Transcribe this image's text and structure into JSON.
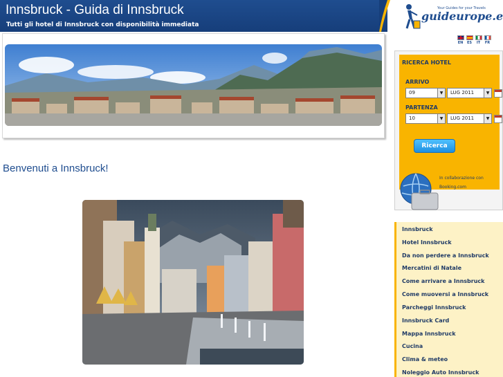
{
  "header": {
    "title": "Innsbruck - Guida di Innsbruck",
    "subtitle": "Tutti gli hotel di Innsbruck con disponibilità immediata"
  },
  "logo": {
    "brand": "guideurope.eu",
    "tagline": "Your Guides for your Travels"
  },
  "languages": [
    {
      "code": "EN"
    },
    {
      "code": "ES"
    },
    {
      "code": "IT"
    },
    {
      "code": "FR"
    }
  ],
  "main": {
    "welcome": "Benvenuti a Innsbruck!"
  },
  "search": {
    "title": "RICERCA HOTEL",
    "arrival_label": "ARRIVO",
    "arrival_day": "09",
    "arrival_month": "LUG 2011",
    "departure_label": "PARTENZA",
    "departure_day": "10",
    "departure_month": "LUG 2011",
    "button_label": "Ricerca",
    "collab_text": "In collaborazione con Booking.com"
  },
  "nav": {
    "items": [
      "Innsbruck",
      "Hotel Innsbruck",
      "Da non perdere a Innsbruck",
      "Mercatini di Natale",
      "Come arrivare a Innsbruck",
      "Come muoversi a Innsbruck",
      "Parcheggi Innsbruck",
      "Innsbruck Card",
      "Mappa Innsbruck",
      "Cucina",
      "Clima & meteo",
      "Noleggio Auto Innsbruck"
    ]
  },
  "colors": {
    "header_blue": "#1f4d8f",
    "search_orange": "#f9b400",
    "nav_bg": "#fdf2c6"
  }
}
